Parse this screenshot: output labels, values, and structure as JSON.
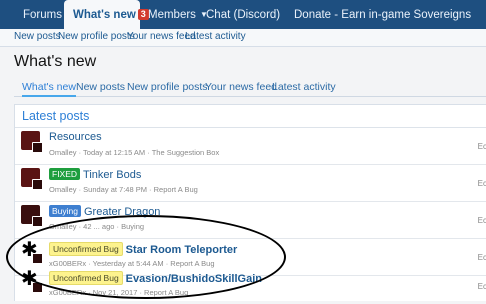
{
  "nav": {
    "forums": "Forums",
    "whats_new": "What's new",
    "whats_new_badge": "3",
    "members": "Members",
    "chat": "Chat (Discord)",
    "donate": "Donate - Earn in-game Sovereigns"
  },
  "subnav": [
    "New posts",
    "New profile posts",
    "Your news feed",
    "Latest activity"
  ],
  "page_title": "What's new",
  "tabs": [
    "What's new",
    "New posts",
    "New profile posts",
    "Your news feed",
    "Latest activity"
  ],
  "latest": {
    "header": "Latest posts",
    "rows": [
      {
        "prefix": "",
        "title": "Resources",
        "meta": "Omalley · Today at 12:15 AM · The Suggestion Box",
        "edge": "Ec"
      },
      {
        "prefix": "FIXED",
        "title": "Tinker Bods",
        "meta": "Omalley · Sunday at 7:48 PM · Report A Bug",
        "edge": "Ec"
      },
      {
        "prefix": "Buying",
        "title": "Greater Dragon",
        "meta": "Omalley · 42 ... ago · Buying",
        "edge": "Ec"
      },
      {
        "prefix": "Unconfirmed Bug",
        "title": "Star Room Teleporter",
        "meta": "xG00BERx · Yesterday at 5:44 AM · Report A Bug",
        "edge": "Ec"
      },
      {
        "prefix": "Unconfirmed Bug",
        "title": "Evasion/BushidoSkillGain",
        "meta": "xG00BERx · Nov 21, 2017 · Report A Bug",
        "edge": "Ec"
      }
    ]
  },
  "colors": {
    "nav_bg": "#1e4f80",
    "link": "#1d5a91",
    "fixed": "#1e9e3e",
    "buying": "#3e7fd0",
    "bug": "#fdf38e"
  }
}
